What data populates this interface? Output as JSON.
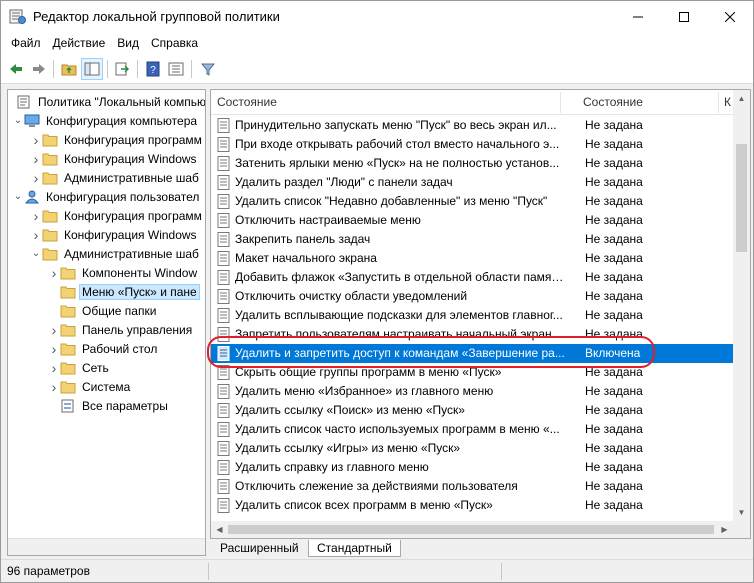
{
  "window": {
    "title": "Редактор локальной групповой политики",
    "minimize": "minimize",
    "maximize": "maximize",
    "close": "close"
  },
  "menu": [
    "Файл",
    "Действие",
    "Вид",
    "Справка"
  ],
  "toolbar": {
    "icons": [
      "back-arrow-icon",
      "forward-arrow-icon",
      "up-folder-icon",
      "show-hide-tree-icon",
      "export-list-icon",
      "help-icon",
      "extended-view-icon",
      "filter-icon"
    ]
  },
  "tree": [
    {
      "label": "Политика \"Локальный компью",
      "level": 0,
      "expand": "",
      "icon": "policy"
    },
    {
      "label": "Конфигурация компьютера",
      "level": 1,
      "expand": "open",
      "icon": "computer"
    },
    {
      "label": "Конфигурация программ",
      "level": 2,
      "expand": "closed",
      "icon": "folder"
    },
    {
      "label": "Конфигурация Windows",
      "level": 2,
      "expand": "closed",
      "icon": "folder"
    },
    {
      "label": "Административные шаб",
      "level": 2,
      "expand": "closed",
      "icon": "folder"
    },
    {
      "label": "Конфигурация пользовател",
      "level": 1,
      "expand": "open",
      "icon": "user"
    },
    {
      "label": "Конфигурация программ",
      "level": 2,
      "expand": "closed",
      "icon": "folder"
    },
    {
      "label": "Конфигурация Windows",
      "level": 2,
      "expand": "closed",
      "icon": "folder"
    },
    {
      "label": "Административные шаб",
      "level": 2,
      "expand": "open",
      "icon": "folder"
    },
    {
      "label": "Компоненты Window",
      "level": 3,
      "expand": "closed",
      "icon": "folder"
    },
    {
      "label": "Меню «Пуск» и пане",
      "level": 3,
      "expand": "",
      "icon": "folder",
      "selected": true
    },
    {
      "label": "Общие папки",
      "level": 3,
      "expand": "",
      "icon": "folder"
    },
    {
      "label": "Панель управления",
      "level": 3,
      "expand": "closed",
      "icon": "folder"
    },
    {
      "label": "Рабочий стол",
      "level": 3,
      "expand": "closed",
      "icon": "folder"
    },
    {
      "label": "Сеть",
      "level": 3,
      "expand": "closed",
      "icon": "folder"
    },
    {
      "label": "Система",
      "level": 3,
      "expand": "closed",
      "icon": "folder"
    },
    {
      "label": "Все параметры",
      "level": 3,
      "expand": "",
      "icon": "settings"
    }
  ],
  "list": {
    "headers": [
      "Состояние",
      "Состояние",
      "К"
    ],
    "rows": [
      {
        "name": "Принудительно запускать меню \"Пуск\" во весь экран ил...",
        "state": "Не задана"
      },
      {
        "name": "При входе открывать рабочий стол вместо начального э...",
        "state": "Не задана"
      },
      {
        "name": "Затенить ярлыки меню «Пуск» на не полностью установ...",
        "state": "Не задана"
      },
      {
        "name": "Удалить раздел \"Люди\" с панели задач",
        "state": "Не задана"
      },
      {
        "name": "Удалить список \"Недавно добавленные\" из меню \"Пуск\"",
        "state": "Не задана"
      },
      {
        "name": "Отключить настраиваемые меню",
        "state": "Не задана"
      },
      {
        "name": "Закрепить панель задач",
        "state": "Не задана"
      },
      {
        "name": "Макет начального экрана",
        "state": "Не задана"
      },
      {
        "name": "Добавить флажок «Запустить в отдельной области памят...",
        "state": "Не задана"
      },
      {
        "name": "Отключить очистку области уведомлений",
        "state": "Не задана"
      },
      {
        "name": "Удалить всплывающие подсказки для элементов главног...",
        "state": "Не задана"
      },
      {
        "name": "Запретить пользователям настраивать начальный экран",
        "state": "Не задана"
      },
      {
        "name": "Удалить и запретить доступ к командам «Завершение ра...",
        "state": "Включена",
        "selected": true
      },
      {
        "name": "Скрыть общие группы программ в меню «Пуск»",
        "state": "Не задана"
      },
      {
        "name": "Удалить меню «Избранное» из главного меню",
        "state": "Не задана"
      },
      {
        "name": "Удалить ссылку «Поиск» из меню «Пуск»",
        "state": "Не задана"
      },
      {
        "name": "Удалить список часто используемых программ в меню «...",
        "state": "Не задана"
      },
      {
        "name": "Удалить ссылку «Игры» из меню «Пуск»",
        "state": "Не задана"
      },
      {
        "name": "Удалить справку из главного меню",
        "state": "Не задана"
      },
      {
        "name": "Отключить слежение за действиями пользователя",
        "state": "Не задана"
      },
      {
        "name": "Удалить список всех программ в меню «Пуск»",
        "state": "Не задана"
      }
    ]
  },
  "tabs": [
    "Расширенный",
    "Стандартный"
  ],
  "status": "96 параметров",
  "colors": {
    "selection": "#0078d7",
    "highlight_ring": "#e0202a",
    "tree_selection": "#cce8ff"
  }
}
